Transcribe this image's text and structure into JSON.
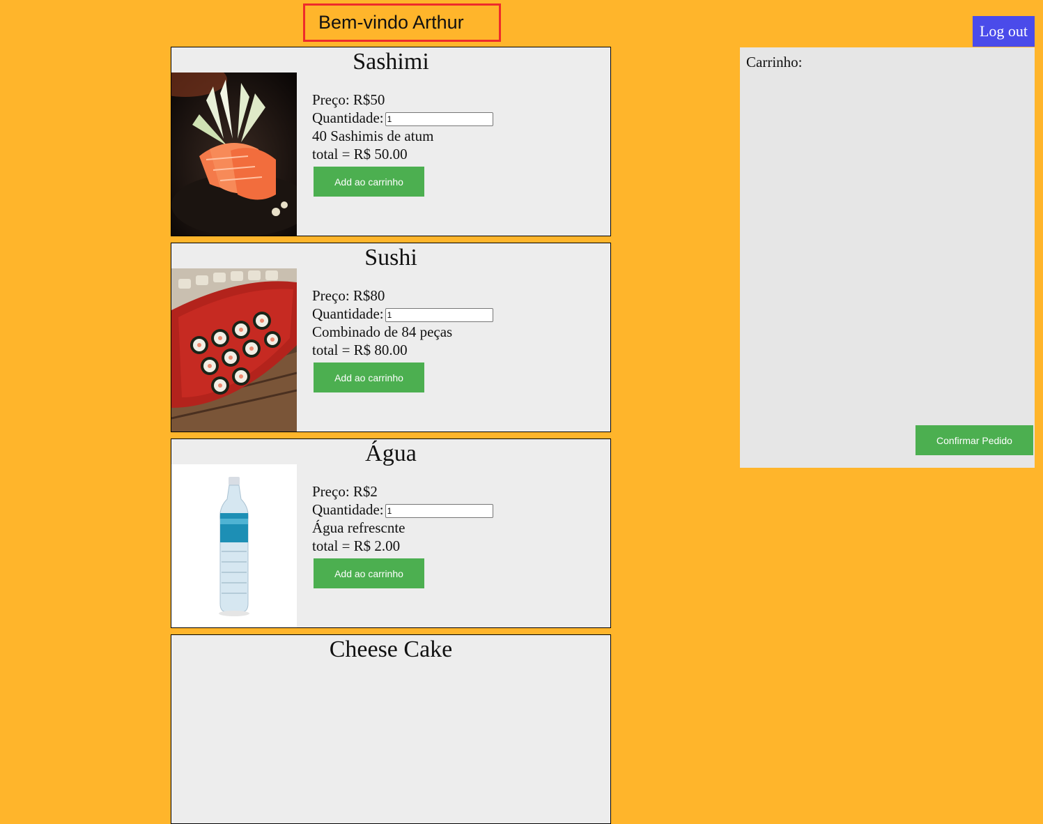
{
  "header": {
    "welcome": "Bem-vindo Arthur",
    "logout_label": "Log out"
  },
  "products": [
    {
      "name": "Sashimi",
      "price": "Preço: R$50",
      "qty_label": "Quantidade:",
      "qty_value": "1",
      "description": "40 Sashimis de atum",
      "total": "total = R$ 50.00",
      "button": "Add ao carrinho",
      "image_icon": "sashimi-photo"
    },
    {
      "name": "Sushi",
      "price": "Preço: R$80",
      "qty_label": "Quantidade:",
      "qty_value": "1",
      "description": "Combinado de 84 peças",
      "total": "total = R$ 80.00",
      "button": "Add ao carrinho",
      "image_icon": "sushi-photo"
    },
    {
      "name": "Água",
      "price": "Preço: R$2",
      "qty_label": "Quantidade:",
      "qty_value": "1",
      "description": "Água refrescnte",
      "total": "total = R$ 2.00",
      "button": "Add ao carrinho",
      "image_icon": "water-bottle-photo"
    },
    {
      "name": "Cheese Cake"
    }
  ],
  "cart": {
    "title": "Carrinho:",
    "confirm_label": "Confirmar Pedido"
  },
  "colors": {
    "background": "#FFB52B",
    "accent_green": "#4CAF50",
    "logout_blue": "#4A4BEA",
    "welcome_border": "#EE2B2B"
  }
}
